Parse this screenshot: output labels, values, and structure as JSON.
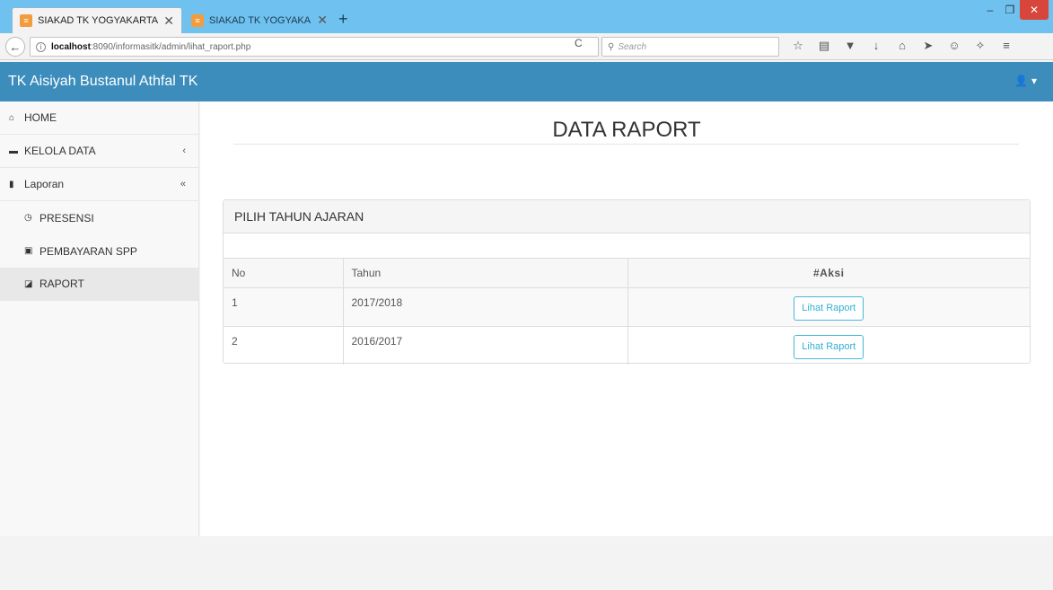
{
  "browser": {
    "tabs": [
      {
        "title": "SIAKAD TK YOGYAKARTA",
        "close": "✕"
      },
      {
        "title": "SIAKAD TK YOGYAKARTA",
        "close": "✕"
      }
    ],
    "new_tab": "+",
    "window_controls": {
      "minimize": "–",
      "maximize": "❐",
      "close": "✕"
    },
    "url_host": "localhost",
    "url_rest": ":8090/informasitk/admin/lihat_raport.php",
    "search_placeholder": "Search",
    "toolbar_icons": [
      "star-icon",
      "reading-list-icon",
      "pocket-icon",
      "download-icon",
      "home-icon",
      "send-icon",
      "smiley-icon",
      "extension-icon",
      "menu-icon"
    ]
  },
  "header": {
    "brand": "TK Aisiyah Bustanul Athfal TK",
    "user_icon": "user-icon"
  },
  "sidebar": {
    "items": [
      {
        "label": "HOME",
        "icon": "home-icon"
      },
      {
        "label": "KELOLA DATA",
        "icon": "folder-icon",
        "caret": "‹"
      },
      {
        "label": "Laporan",
        "icon": "file-icon",
        "caret": "«"
      }
    ],
    "subitems": [
      {
        "label": "PRESENSI",
        "icon": "clock-icon"
      },
      {
        "label": "PEMBAYARAN SPP",
        "icon": "money-icon"
      },
      {
        "label": "RAPORT",
        "icon": "book-icon"
      }
    ]
  },
  "main": {
    "title": "DATA RAPORT",
    "panel_heading": "PILIH TAHUN AJARAN",
    "table": {
      "headers": [
        "No",
        "Tahun",
        "#Aksi"
      ],
      "rows": [
        {
          "no": "1",
          "tahun": "2017/2018",
          "action": "Lihat Raport"
        },
        {
          "no": "2",
          "tahun": "2016/2017",
          "action": "Lihat Raport"
        }
      ]
    }
  },
  "colors": {
    "header": "#3c8dbc",
    "titlebar": "#6fc1ef",
    "button_border": "#46b8da"
  }
}
